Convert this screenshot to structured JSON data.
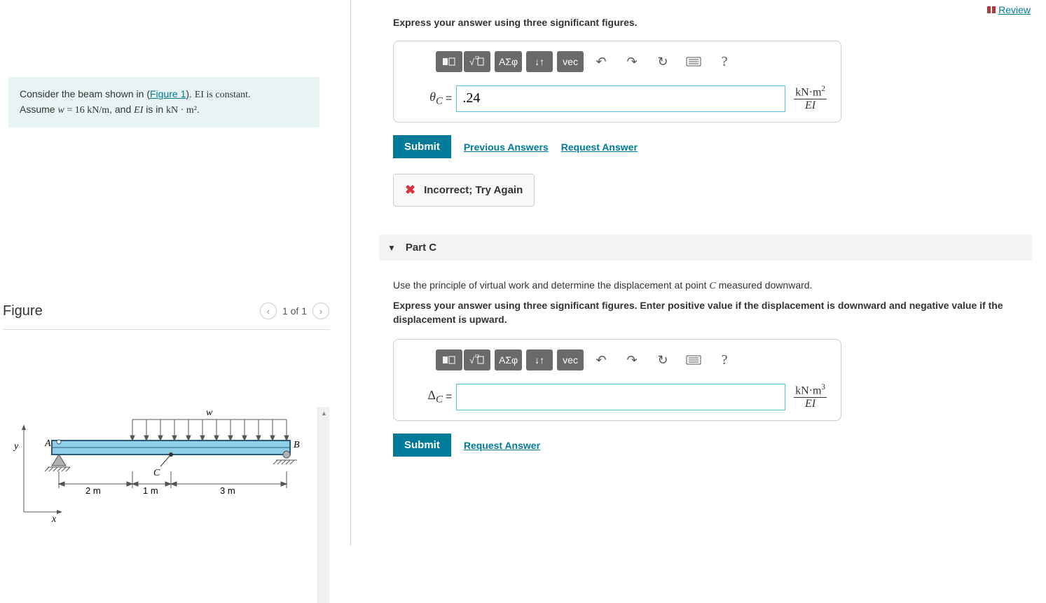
{
  "review_label": " Review",
  "problem": {
    "pre": "Consider the beam shown in (",
    "figure_link": "Figure 1",
    "mid": "). ",
    "ei_const": "EI is constant.",
    "assume_pre": "Assume ",
    "w_eq": "w",
    "w_val": " = 16 kN/m",
    "and": ", and ",
    "ei": "EI",
    "isin": " is in ",
    "unit": "kN · m²",
    "dot": "."
  },
  "figure": {
    "title": "Figure",
    "pager": "1 of 1",
    "labels": {
      "w": "w",
      "A": "A",
      "B": "B",
      "C": "C",
      "y": "y",
      "x": "x"
    },
    "dims": {
      "d1": "2 m",
      "d2": "1 m",
      "d3": "3 m"
    }
  },
  "partB": {
    "instruction": "Express your answer using three significant figures.",
    "toolbar": {
      "greek": "ΑΣφ",
      "vec": "vec",
      "help": "?"
    },
    "var": "θ",
    "sub": "C",
    "eq": " = ",
    "value": ".24",
    "unit_num": "kN·m²",
    "unit_den": "EI",
    "submit": "Submit",
    "prev": "Previous Answers",
    "req": "Request Answer",
    "feedback": "Incorrect; Try Again"
  },
  "partC": {
    "header": "Part C",
    "text1": "Use the principle of virtual work and determine the displacement at point ",
    "Cvar": "C",
    "text2": " measured downward.",
    "instruction": "Express your answer using three significant figures. Enter positive value if the displacement is downward and negative value if the displacement is upward.",
    "toolbar": {
      "greek": "ΑΣφ",
      "vec": "vec",
      "help": "?"
    },
    "var": "Δ",
    "sub": "C",
    "eq": " = ",
    "value": "",
    "unit_num": "kN·m³",
    "unit_den": "EI",
    "submit": "Submit",
    "req": "Request Answer"
  }
}
